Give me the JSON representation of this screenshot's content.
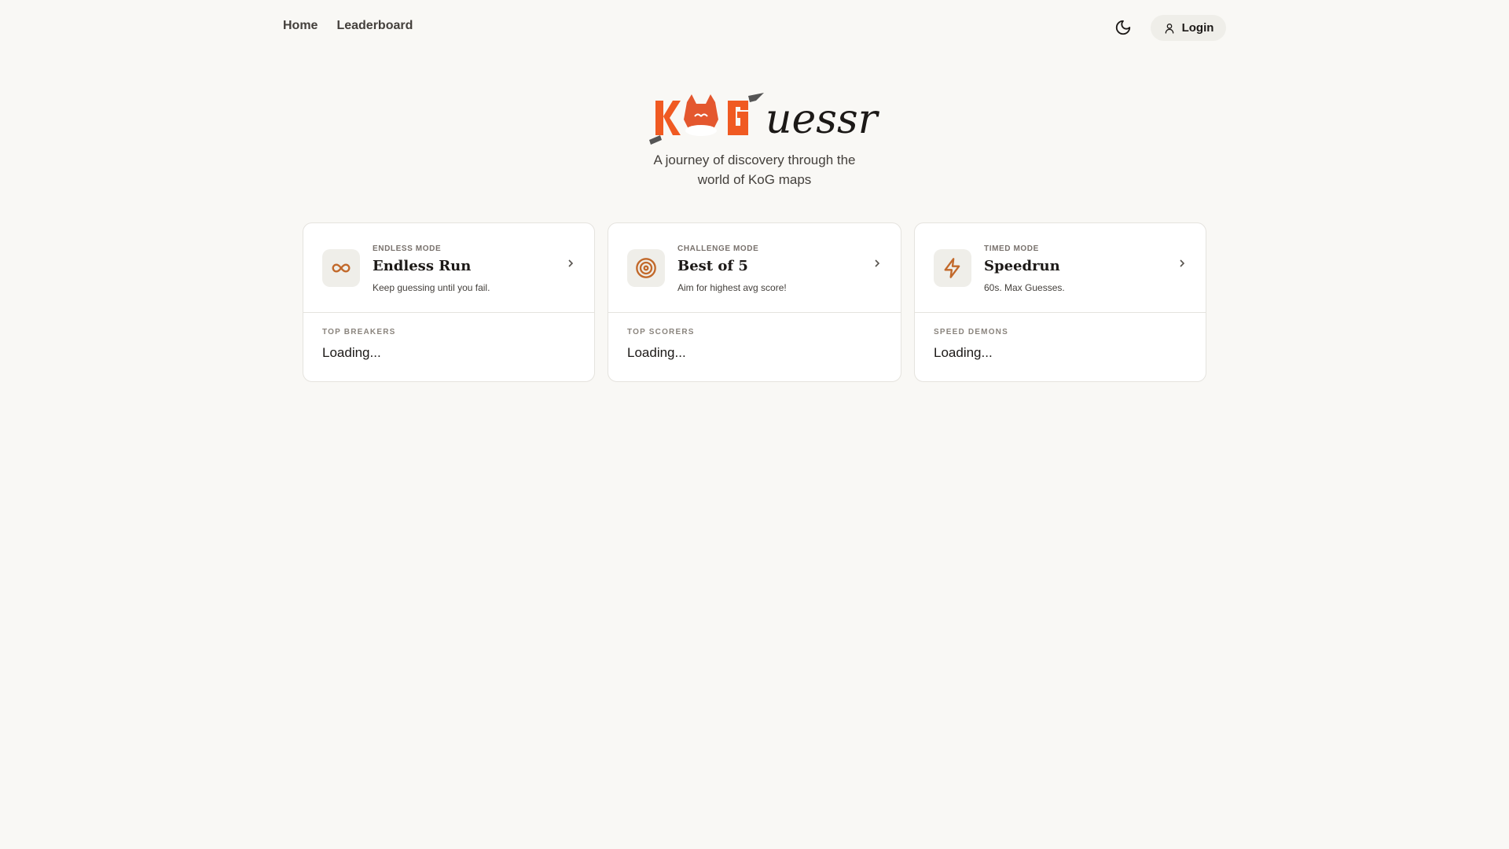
{
  "nav": {
    "home": "Home",
    "leaderboard": "Leaderboard",
    "login": "Login"
  },
  "logo": {
    "kog": "KoG",
    "suffix": "uessr"
  },
  "subtitle": {
    "line1": "A journey of discovery through the",
    "line2": "world of KoG maps"
  },
  "accent": "#c2692b",
  "cards": [
    {
      "mode": "ENDLESS MODE",
      "title": "Endless Run",
      "desc": "Keep guessing until you fail.",
      "board": "TOP BREAKERS",
      "status": "Loading...",
      "icon": "infinity-icon"
    },
    {
      "mode": "CHALLENGE MODE",
      "title": "Best of 5",
      "desc": "Aim for highest avg score!",
      "board": "TOP SCORERS",
      "status": "Loading...",
      "icon": "target-icon"
    },
    {
      "mode": "TIMED MODE",
      "title": "Speedrun",
      "desc": "60s. Max Guesses.",
      "board": "SPEED DEMONS",
      "status": "Loading...",
      "icon": "lightning-icon"
    }
  ]
}
